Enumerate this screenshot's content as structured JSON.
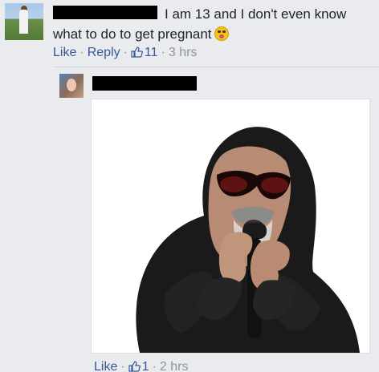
{
  "main_comment": {
    "author_redacted": true,
    "text": "I am 13 and I don't even know what to do to get pregnant",
    "emoji_icon": "tongue-out-emoji-icon",
    "actions": {
      "like_label": "Like",
      "reply_label": "Reply",
      "like_count": "11",
      "time": "3 hrs"
    }
  },
  "reply_comment": {
    "author_redacted": true,
    "image_icon": "hooded-man-microphone-photo",
    "actions": {
      "like_label": "Like",
      "like_count": "1",
      "time": "2 hrs"
    }
  },
  "colors": {
    "background": "#e9ebee",
    "link": "#365899",
    "text": "#1d2129",
    "meta": "#90949c",
    "redaction": "#000000"
  }
}
